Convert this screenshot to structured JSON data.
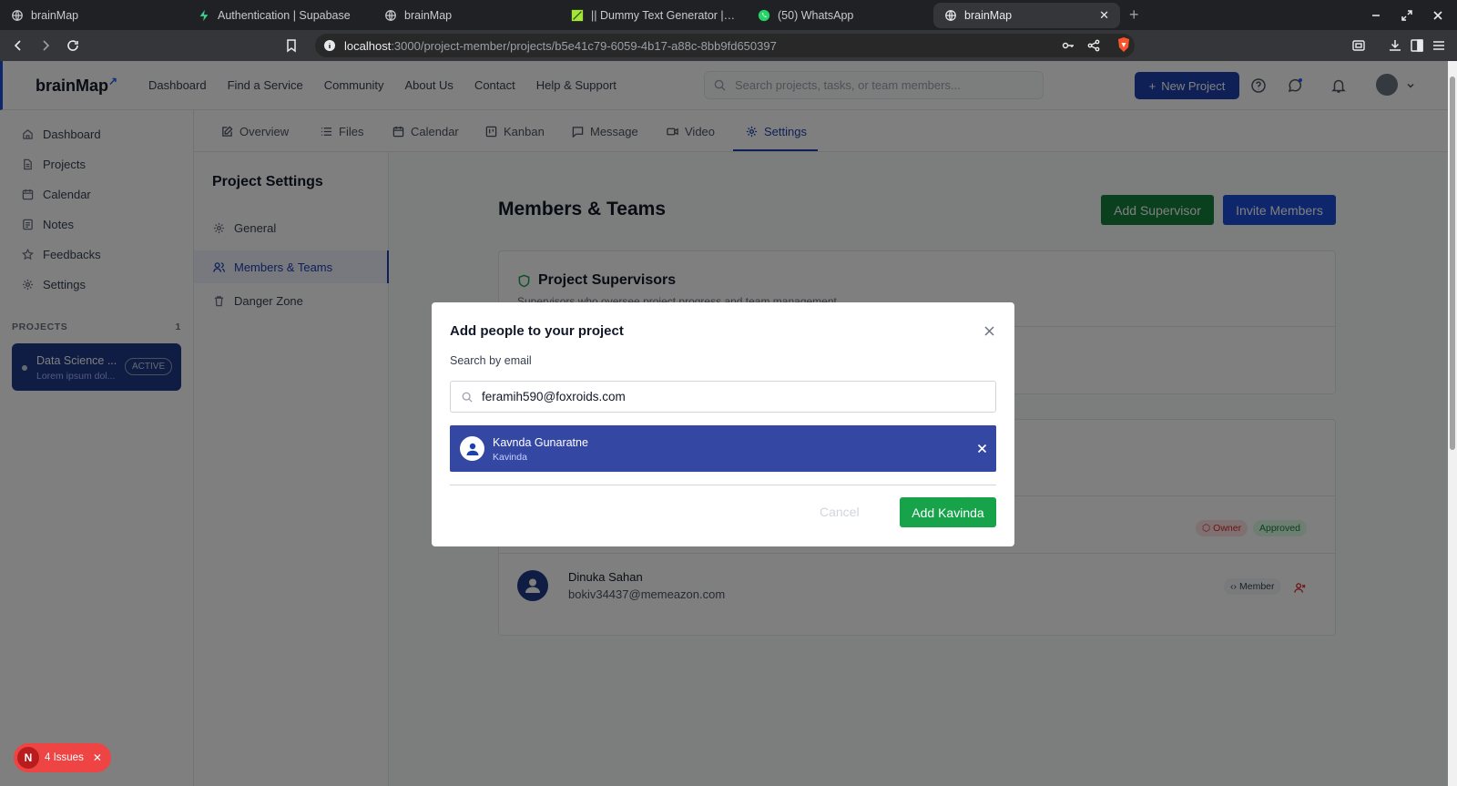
{
  "browser": {
    "tabs": [
      {
        "label": "brainMap",
        "active": false
      },
      {
        "label": "Authentication | Supabase",
        "active": false
      },
      {
        "label": "brainMap",
        "active": false
      },
      {
        "label": "|| Dummy Text Generator | Lorem",
        "active": false
      },
      {
        "label": "(50) WhatsApp",
        "active": false
      },
      {
        "label": "brainMap",
        "active": true
      }
    ],
    "url_host": "localhost",
    "url_path": ":3000/project-member/projects/b5e41c79-6059-4b17-a88c-8bb9fd650397"
  },
  "app": {
    "logo": "brainMap",
    "nav": [
      "Dashboard",
      "Find a Service",
      "Community",
      "About Us",
      "Contact",
      "Help & Support"
    ],
    "search_placeholder": "Search projects, tasks, or team members...",
    "new_project": "New Project"
  },
  "sidebar": {
    "items": [
      "Dashboard",
      "Projects",
      "Calendar",
      "Notes",
      "Feedbacks",
      "Settings"
    ],
    "projects_label": "PROJECTS",
    "projects_count": "1",
    "project": {
      "name": "Data Science ...",
      "desc": "Lorem ipsum dol...",
      "badge": "ACTIVE"
    }
  },
  "project_tabs": [
    "Overview",
    "Files",
    "Calendar",
    "Kanban",
    "Message",
    "Video",
    "Settings"
  ],
  "settings": {
    "title": "Project Settings",
    "menu": [
      "General",
      "Members & Teams",
      "Danger Zone"
    ]
  },
  "main": {
    "title": "Members & Teams",
    "add_supervisor": "Add Supervisor",
    "invite_members": "Invite Members",
    "supervisors_title": "Project Supervisors",
    "supervisors_sub": "Supervisors who oversee project progress and team management",
    "owner_tag": "Owner",
    "approved_tag": "Approved",
    "member": {
      "name": "Dinuka Sahan",
      "email": "bokiv34437@memeazon.com",
      "role": "Member"
    }
  },
  "modal": {
    "title": "Add people to your project",
    "label": "Search by email",
    "input_value": "feramih590@foxroids.com",
    "selected": {
      "name": "Kavnda Gunaratne",
      "username": "Kavinda"
    },
    "cancel": "Cancel",
    "add": "Add Kavinda"
  },
  "issues": {
    "letter": "N",
    "label": "4 Issues"
  },
  "colors": {
    "primary": "#1e40af",
    "success": "#16a34a",
    "danger": "#dc2626"
  }
}
